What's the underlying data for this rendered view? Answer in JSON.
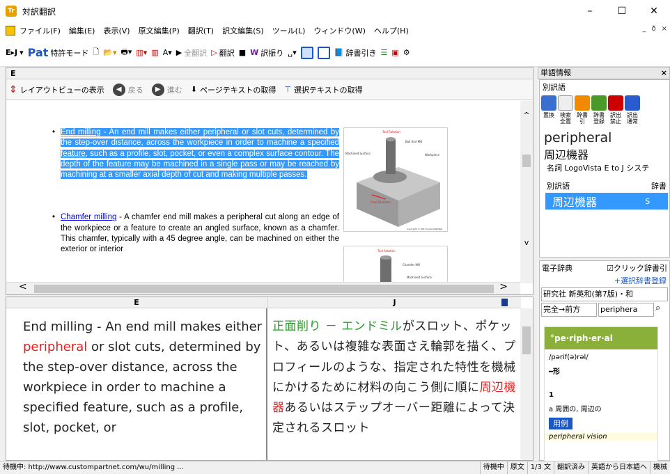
{
  "window": {
    "title": "対訳翻訳",
    "minimize": "–",
    "maximize": "☐",
    "close": "✕"
  },
  "menu": [
    "ファイル(F)",
    "編集(E)",
    "表示(V)",
    "原文編集(P)",
    "翻訳(T)",
    "訳文編集(S)",
    "ツール(L)",
    "ウィンドウ(W)",
    "ヘルプ(H)"
  ],
  "menu_mdi": [
    "_",
    "ð",
    "×"
  ],
  "toolbar": {
    "dir": "E▸J",
    "pat": "Pat",
    "pat_mode": "特許モード",
    "zen_translate": "全翻訳",
    "translate": "翻訳",
    "assign": "訳振り",
    "dict_lookup": "辞書引き"
  },
  "epane": {
    "header": "E",
    "layout_view": "レイアウトビューの表示",
    "back": "戻る",
    "forward": "進む",
    "get_page_text": "ページテキストの取得",
    "get_selected_text": "選択テキストの取得"
  },
  "web": {
    "item1_link": "End milling",
    "item1_text1": " - An end mill makes either peripheral or slot cuts, determined by the step-over distance, across the workpiece in order to machine a specified ",
    "item1_link2": "feature",
    "item1_text2": ", such as a profile, slot, pocket, or even a complex surface contour. The depth of the feature may be machined in a single pass or may be reached by machining at a smaller axial depth of cut and making multiple passes.",
    "item2_link": "Chamfer milling",
    "item2_text": " - A chamfer end mill makes a peripheral cut along an edge of the workpiece or a feature to create an angled surface, known as a chamfer. This chamfer, typically with a 45 degree angle, can be machined on either the exterior or interior",
    "fig1_labels": [
      "Tool Rotation",
      "Ball End Mill",
      "Machined Surface",
      "Workpiece",
      "Feed Direction",
      "Copyright © 2007 CustomPartNet"
    ],
    "fig2_labels": [
      "Tool Rotation",
      "Chamfer Mill",
      "Machined Surface"
    ]
  },
  "bottom": {
    "src_header": "E",
    "tgt_header": "J",
    "src_pre": "End milling - An end mill makes either ",
    "src_red": "peripheral",
    "src_post": " or slot cuts, determined by the step-over distance, across the workpiece in order to machine a specified feature, such as a profile, slot, pocket, or",
    "tgt_green": "正面削り － エンドミル",
    "tgt_pre": "がスロット、ポケット、あるいは複雑な表面さえ輪郭を描く、プロフィールのような、指定された特性を機械にかけるために材料の向こう側に順に",
    "tgt_red": "周辺機器",
    "tgt_post": "あるいはステップオーバー距離によって決定されるスロット"
  },
  "rpanel": {
    "title": "単語情報",
    "close": "×",
    "alt_title": "別訳語",
    "icons": [
      "置換",
      "検索全置",
      "辞書引",
      "辞書登録",
      "訳出禁止",
      "訳出通常"
    ],
    "word": "peripheral",
    "word_jp": "周辺機器",
    "pos": "名詞 LogoVista E to J システ",
    "table_h1": "別訳語",
    "table_h2": "辞書",
    "table_val": "周辺機器",
    "table_dict": "S",
    "edict_title": "電子辞典",
    "click_dict": "☑クリック辞書引",
    "sel_dict_reg": "+選択辞書登録",
    "dict_name": "研究社 新英和(第7版)・和",
    "search_mode": "完全→前方",
    "search_word": "periphera",
    "entry_head": "°pe·riph·er·al",
    "pron": "/pərif(ə)rəl/",
    "form": "━形",
    "num": "1",
    "sense": "a 周囲の, 周辺の",
    "example_btn": "用例",
    "example": "peripheral vision"
  },
  "status": {
    "left": "待機中: http://www.custompartnet.com/wu/milling ...",
    "s1": "待機中",
    "s2": "原文",
    "s3": "1/3 文",
    "s4": "翻訳済み",
    "s5": "英語から日本語へ",
    "s6": "機械"
  },
  "colors": {
    "selection": "#3399ff",
    "accent_green": "#8bb03a",
    "red": "#e82020",
    "green": "#2c9a2c"
  }
}
